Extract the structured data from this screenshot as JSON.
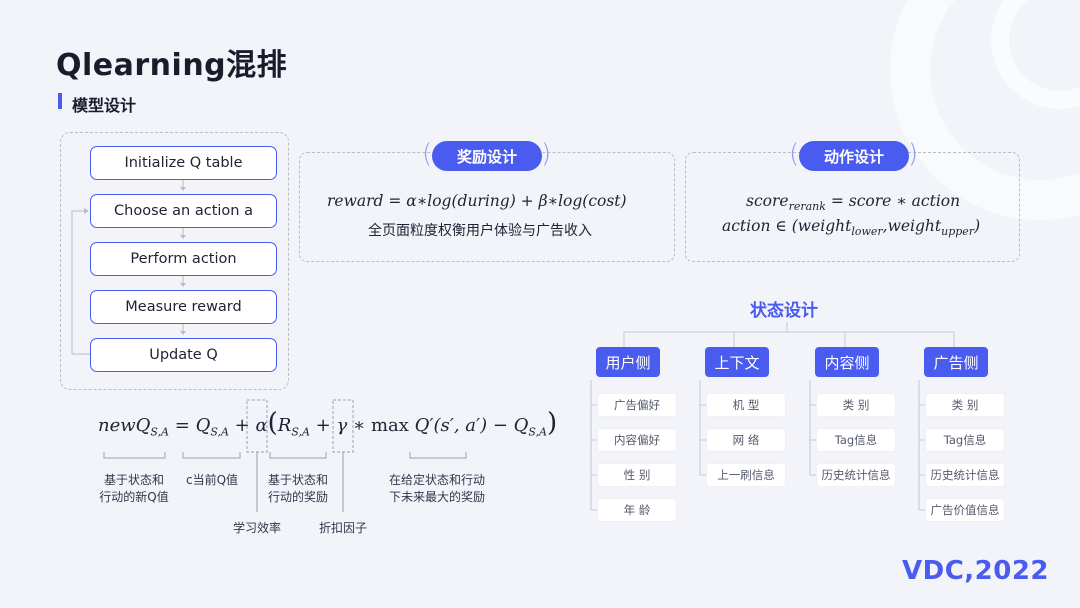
{
  "header": {
    "title": "Qlearning混排",
    "section": "模型设计"
  },
  "flow": {
    "steps": [
      "Initialize Q table",
      "Choose an action a",
      "Perform action",
      "Measure reward",
      "Update Q"
    ]
  },
  "reward_card": {
    "title": "奖励设计",
    "formula": "reward = α∗log(during) + β∗log(cost)",
    "desc": "全页面粒度权衡用户体验与广告收入"
  },
  "action_card": {
    "title": "动作设计",
    "formula1_parts": [
      "score",
      "rerank",
      " = score  ∗ action"
    ],
    "formula2_parts": [
      "action ∈ (weight",
      "lower",
      ",weight",
      "upper",
      ")"
    ]
  },
  "equation": {
    "lhs": "newQ",
    "sa": "S,A",
    "q": "Q",
    "alpha": "α",
    "r": "R",
    "gamma": "γ",
    "max": "max",
    "qprime": "Q′(s′, a′)",
    "labels": {
      "new_q": [
        "基于状态和",
        "行动的新Q值"
      ],
      "current_q": "c当前Q值",
      "reward": [
        "基于状态和",
        "行动的奖励"
      ],
      "future": [
        "在给定状态和行动",
        "下未来最大的奖励"
      ],
      "learning_rate": "学习效率",
      "discount": "折扣因子"
    }
  },
  "state": {
    "title": "状态设计",
    "categories": [
      {
        "name": "用户侧",
        "items": [
          "广告偏好",
          "内容偏好",
          "性 别",
          "年 龄"
        ]
      },
      {
        "name": "上下文",
        "items": [
          "机 型",
          "网 络",
          "上一刷信息"
        ]
      },
      {
        "name": "内容侧",
        "items": [
          "类 别",
          "Tag信息",
          "历史统计信息"
        ]
      },
      {
        "name": "广告侧",
        "items": [
          "类 别",
          "Tag信息",
          "历史统计信息",
          "广告价值信息"
        ]
      }
    ]
  },
  "logo": "VDC,2022",
  "colors": {
    "accent": "#4a5cf0",
    "background": "#f2f4f9"
  }
}
